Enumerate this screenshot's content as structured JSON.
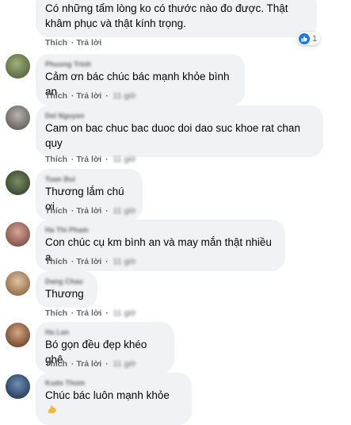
{
  "action_labels": {
    "like": "Thích",
    "reply": "Trả lời"
  },
  "reaction": {
    "icon": "like-icon",
    "count": "1",
    "color": "#1877f2"
  },
  "comments": [
    {
      "text": "Có những tấm lòng ko có thước nào đo được. Thật khâm phục và thật kính trọng."
    },
    {
      "author": "Phuong Trinh",
      "text": "Cảm ơn bác chúc bác mạnh khỏe bình an",
      "time": "11 giờ"
    },
    {
      "author": "Del Nguyen",
      "text": "Cam on bac chuc bac duoc doi dao suc khoe rat chan quy",
      "time": "11 giờ"
    },
    {
      "author": "Tuan Bui",
      "text": "Thương lắm chú ơi",
      "time": "11 giờ"
    },
    {
      "author": "Ha Thi Pham",
      "text": "Con chúc cụ km bình an và may mắn thật nhiều ạ",
      "time": "11 giờ"
    },
    {
      "author": "Dang Chau",
      "text": "Thương",
      "time": "11 giờ"
    },
    {
      "author": "Ha Lan",
      "text": "Bó gọn đều đẹp khéo ghê",
      "time": "11 giờ"
    },
    {
      "author": "Kudo Thom",
      "text": "Chúc bác luôn mạnh khỏe",
      "emoji": "flexed-biceps-icon",
      "time": ""
    }
  ]
}
